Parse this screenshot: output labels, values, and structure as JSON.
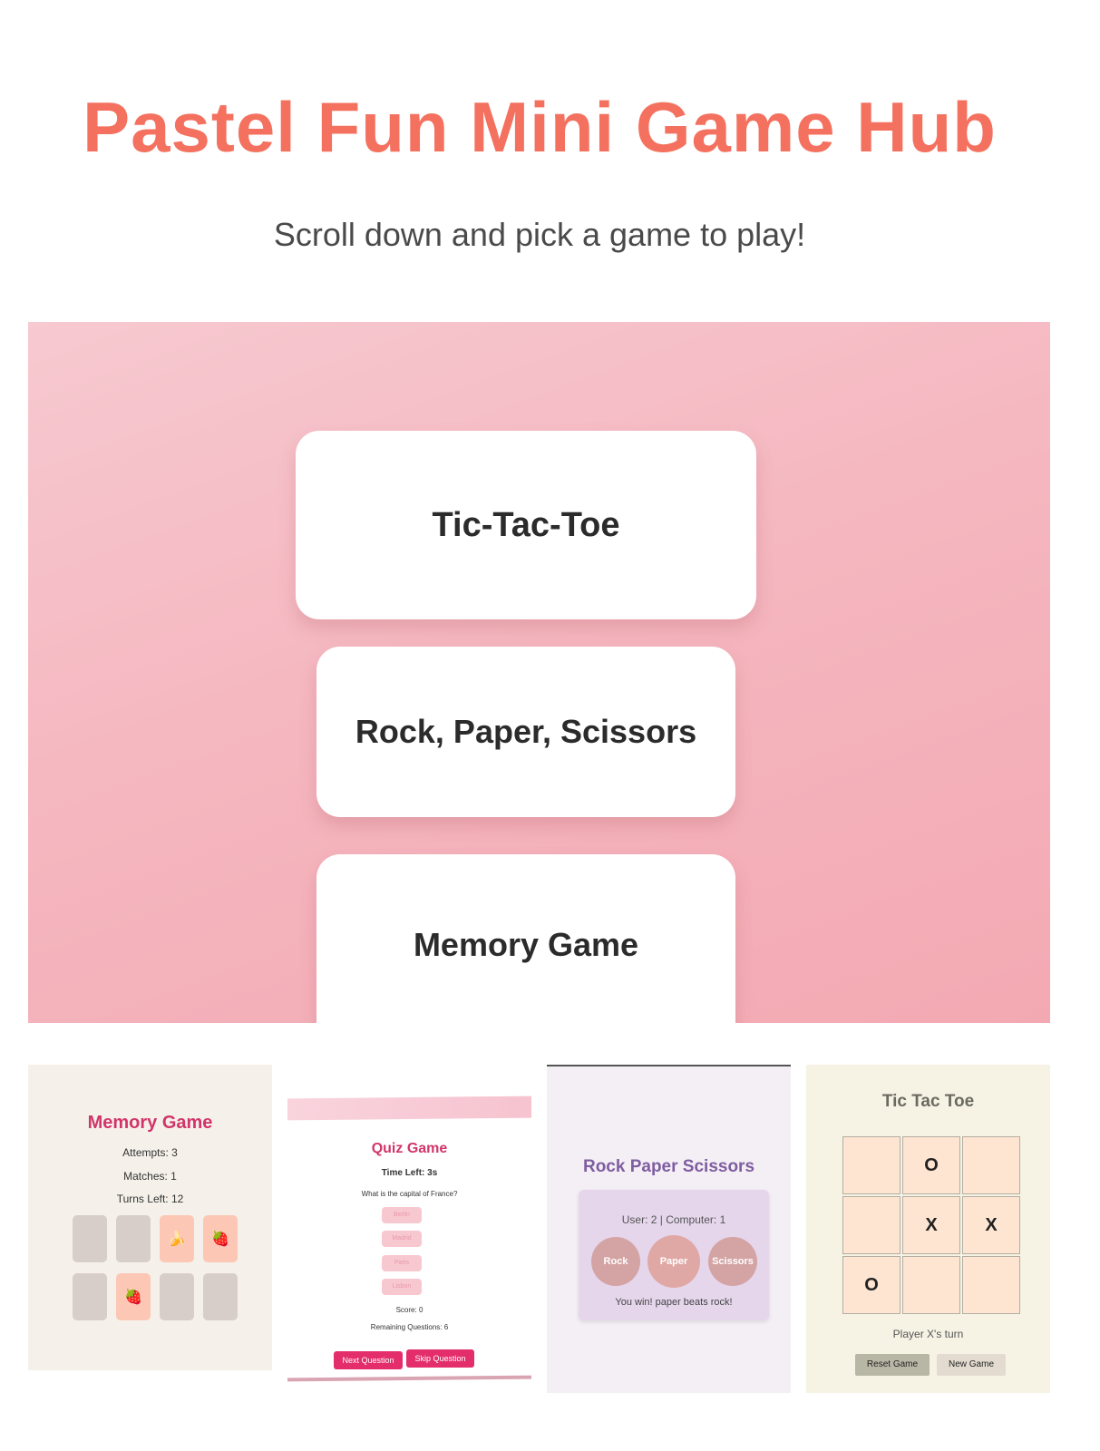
{
  "header": {
    "title": "Pastel Fun Mini Game Hub",
    "subtitle": "Scroll down and pick a game to play!"
  },
  "menu": {
    "cards": [
      "Tic-Tac-Toe",
      "Rock, Paper, Scissors",
      "Memory Game"
    ]
  },
  "colors": {
    "title": "#f4715f",
    "hero_gradient_start": "#f7c9d0",
    "hero_gradient_end": "#f3a9b2",
    "accent_pink": "#d1356b",
    "rps_purple": "#7f5ea0"
  },
  "memory": {
    "title": "Memory Game",
    "attempts": "Attempts: 3",
    "matches": "Matches: 1",
    "turns_left": "Turns Left: 12",
    "tiles": [
      "",
      "",
      "🍌",
      "🍓",
      "",
      "🍓",
      "",
      ""
    ]
  },
  "quiz": {
    "title": "Quiz Game",
    "timer": "Time Left: 3s",
    "question": "What is the capital of France?",
    "options": [
      "Berlin",
      "Madrid",
      "Paris",
      "Lisbon"
    ],
    "score": "Score: 0",
    "remaining": "Remaining Questions: 6",
    "next_label": "Next Question",
    "skip_label": "Skip Question"
  },
  "rps": {
    "title": "Rock Paper Scissors",
    "score": "User: 2 | Computer: 1",
    "buttons": [
      "Rock",
      "Paper",
      "Scissors"
    ],
    "result": "You win! paper beats rock!"
  },
  "tictactoe": {
    "title": "Tic Tac Toe",
    "board": [
      "",
      "O",
      "",
      "",
      "X",
      "X",
      "O",
      "",
      ""
    ],
    "status": "Player X's turn",
    "reset_label": "Reset Game",
    "new_label": "New Game"
  }
}
